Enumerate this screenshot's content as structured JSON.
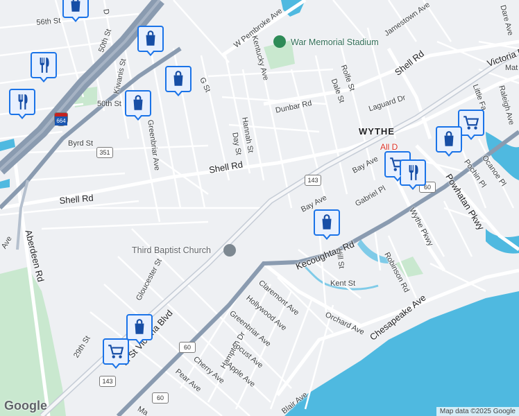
{
  "map": {
    "area_label": "WYTHE",
    "landmarks": {
      "stadium": "War Memorial Stadium",
      "church": "Third Baptist Church",
      "hospital": "All D"
    },
    "streets": {
      "w_pembroke": "W Pembroke Ave",
      "s56": "56th St",
      "s50a": "50th St",
      "s50b": "50th St",
      "kiwanis": "Kiwanis St",
      "d": "D",
      "g": "G St",
      "kentucky": "Kentucky Ave",
      "jamestown": "Jamestown Ave",
      "shell_top": "Shell Rd",
      "rolfe": "Rolfe St",
      "dale": "Dale St",
      "dunbar": "Dunbar Rd",
      "laguard": "Laguard Dr",
      "little": "Little Fa",
      "raleigh": "Raleigh Ave",
      "dare": "Dare Ave",
      "victoria_ne": "Victoria Bl",
      "mat": "Mat",
      "hannah": "Hannah St",
      "day": "Day St",
      "greenbriar_n": "Greenbriar Ave",
      "byrd": "Byrd St",
      "shell_mid": "Shell Rd",
      "shell_left": "Shell Rd",
      "bay1": "Bay Ave",
      "bay2": "Bay Ave",
      "gabriel": "Gabriel Pl",
      "ocanoe": "Ocanoe Pl",
      "pochin": "Pochin Pl",
      "powhatan": "Powhatan Pkwy",
      "wythe_pkwy": "Wythe Pkwy",
      "aberdeen": "Aberdeen Rd",
      "kecoughtan": "Kecoughtan Rd",
      "hill": "Hill St",
      "robinson": "Robinson Rd",
      "kent": "Kent St",
      "gloucester": "Gloucester St",
      "claremont": "Claremont Ave",
      "hollywood": "Hollywood Ave",
      "greenbriar_s": "Greenbriar Ave",
      "hampton": "Hampton Dr",
      "locust": "Locust Ave",
      "apple": "Apple Ave",
      "cherry": "Cherry Ave",
      "pear": "Pear Ave",
      "orchard": "Orchard Ave",
      "chesapeake": "Chesapeake Ave",
      "blair": "Blair Ave",
      "victoria_sw": "th St Victoria Blvd",
      "s29": "29th St",
      "ma": "Ma",
      "ave_left": "Ave"
    },
    "shields": {
      "r351": "351",
      "r143a": "143",
      "r143b": "143",
      "r60a": "60",
      "r60b": "60",
      "i664": "664"
    },
    "attribution": "Map data ©2025 Google",
    "logo": "Google"
  },
  "pins": [
    {
      "type": "shopping-bag",
      "label": "shopping"
    },
    {
      "type": "shopping-bag",
      "label": "shopping"
    },
    {
      "type": "shopping-bag",
      "label": "shopping"
    },
    {
      "type": "restaurant",
      "label": "restaurant"
    },
    {
      "type": "restaurant",
      "label": "restaurant"
    },
    {
      "type": "shopping-bag",
      "label": "shopping"
    },
    {
      "type": "shopping-cart",
      "label": "grocery"
    },
    {
      "type": "shopping-bag",
      "label": "shopping"
    },
    {
      "type": "shopping-cart",
      "label": "grocery"
    },
    {
      "type": "restaurant",
      "label": "restaurant"
    },
    {
      "type": "shopping-bag",
      "label": "shopping"
    },
    {
      "type": "shopping-bag",
      "label": "shopping"
    },
    {
      "type": "shopping-cart",
      "label": "grocery"
    }
  ],
  "colors": {
    "land": "#eef0f3",
    "water": "#4fb9e0",
    "park": "#c9e8cf",
    "highway": "#8a9bb0",
    "arterial": "#ffffff",
    "pin_border": "#1a73e8",
    "pin_fill": "#e8f0fe",
    "icon": "#174ea6"
  }
}
